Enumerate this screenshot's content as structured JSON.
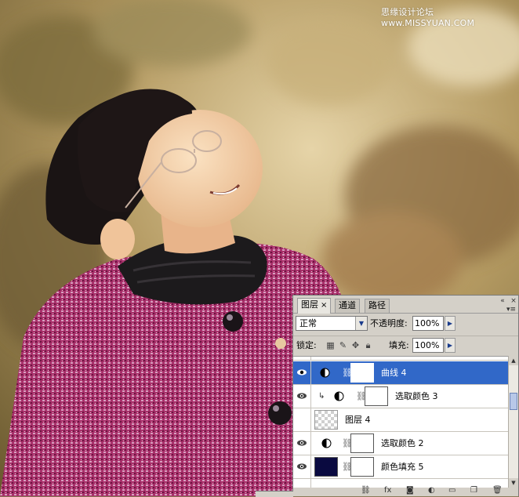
{
  "watermark": "思缘设计论坛 www.MISSYUAN.COM",
  "panel": {
    "tabs": [
      {
        "label": "图层",
        "close": "×",
        "active": true
      },
      {
        "label": "通道",
        "active": false
      },
      {
        "label": "路径",
        "active": false
      }
    ],
    "blend_mode": "正常",
    "opacity_label": "不透明度:",
    "opacity_value": "100%",
    "lock_label": "锁定:",
    "fill_label": "填充:",
    "fill_value": "100%",
    "layers": [
      {
        "name": "曲线 4",
        "type": "adjustment",
        "selected": true
      },
      {
        "name": "选取颜色 3",
        "type": "adjustment",
        "clipped": true
      },
      {
        "name": "图层 4",
        "type": "pixel",
        "hidden_eye": true
      },
      {
        "name": "选取颜色 2",
        "type": "adjustment"
      },
      {
        "name": "颜色填充 5",
        "type": "fill"
      }
    ]
  },
  "colors": {
    "selection": "#3168c8",
    "fill_swatch": "#0a0a40",
    "coat": "#b0306c"
  }
}
